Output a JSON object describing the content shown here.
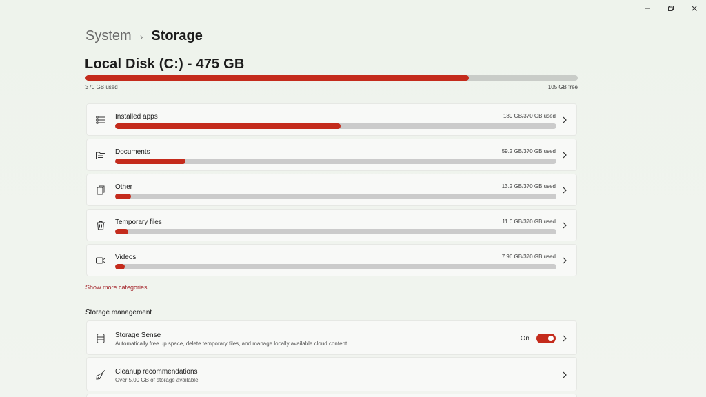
{
  "window": {
    "minimize_icon": "minimize-icon",
    "maximize_icon": "restore-icon",
    "close_icon": "close-icon"
  },
  "breadcrumb": {
    "parent": "System",
    "separator": "›",
    "current": "Storage"
  },
  "disk": {
    "title": "Local Disk (C:) - 475 GB",
    "used_label": "370 GB used",
    "free_label": "105 GB free",
    "used_fraction": 0.779,
    "accent": "#c42b1c"
  },
  "categories": [
    {
      "label": "Installed apps",
      "amount": "189 GB/370 GB used",
      "fraction": 0.511,
      "icon": "list-icon"
    },
    {
      "label": "Documents",
      "amount": "59.2 GB/370 GB used",
      "fraction": 0.16,
      "icon": "folder-icon"
    },
    {
      "label": "Other",
      "amount": "13.2 GB/370 GB used",
      "fraction": 0.036,
      "icon": "copy-icon"
    },
    {
      "label": "Temporary files",
      "amount": "11.0 GB/370 GB used",
      "fraction": 0.03,
      "icon": "trash-icon"
    },
    {
      "label": "Videos",
      "amount": "7.96 GB/370 GB used",
      "fraction": 0.022,
      "icon": "video-icon"
    }
  ],
  "show_more": "Show more categories",
  "management": {
    "title": "Storage management",
    "items": [
      {
        "title": "Storage Sense",
        "subtitle": "Automatically free up space, delete temporary files, and manage locally available cloud content",
        "toggle_label": "On",
        "toggle_on": true,
        "icon": "drive-icon"
      },
      {
        "title": "Cleanup recommendations",
        "subtitle": "Over 5.00 GB of storage available.",
        "icon": "broom-icon"
      }
    ]
  }
}
